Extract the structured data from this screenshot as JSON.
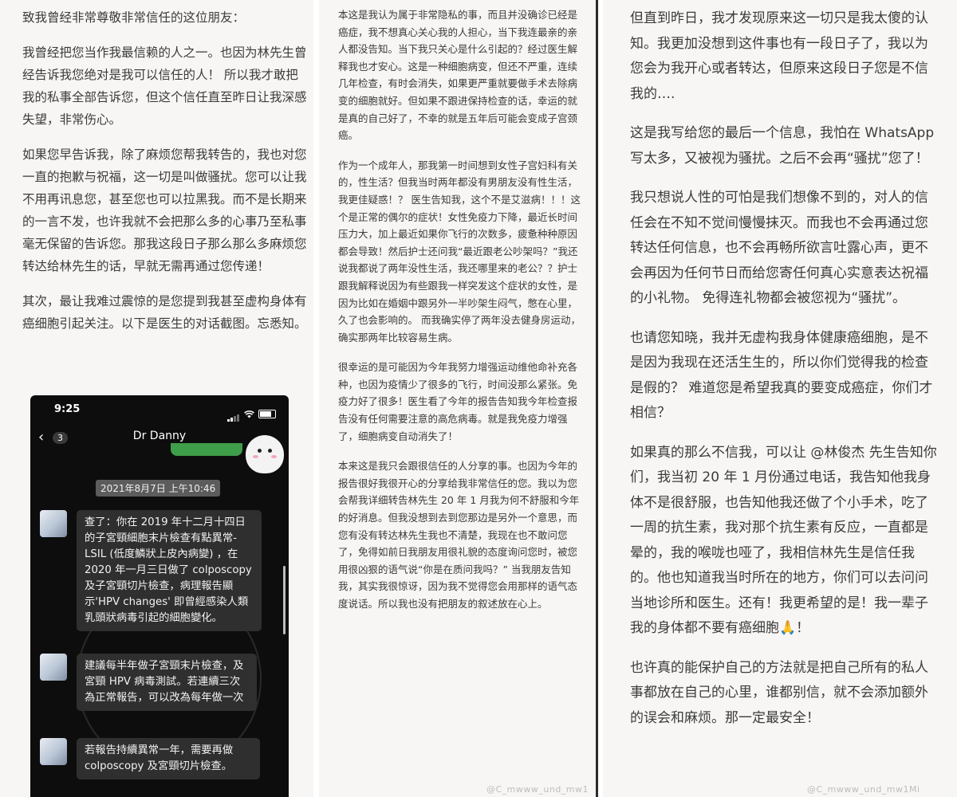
{
  "col1": {
    "paragraphs": [
      "致我曾经非常尊敬非常信任的这位朋友：",
      "我曾经把您当作我最信赖的人之一。也因为林先生曾经告诉我您绝对是我可以信任的人！ 所以我才敢把我的私事全部告诉您，但这个信任直至昨日让我深感失望，非常伤心。",
      "如果您早告诉我，除了麻烦您帮我转告的，我也对您一直的抱歉与祝福，这一切是叫做骚扰。您可以让我不用再讯息您，甚至您也可以拉黑我。而不是长期来的一言不发，也许我就不会把那么多的心事乃至私事毫无保留的告诉您。那我这段日子那么那么多麻烦您转达给林先生的话，早就无需再通过您传递！",
      "其次，最让我难过震惊的是您提到我甚至虚构身体有癌细胞引起关注。以下是医生的对话截图。忘悉知。"
    ]
  },
  "phone": {
    "time": "9:25",
    "back_count": "3",
    "chat_title": "Dr Danny",
    "date_pill": "2021年8月7日 上午10:46",
    "messages": [
      "查了：你在 2019 年十二月十四日的子宮頸細胞末片檢查有點異常-LSIL (低度鱗狀上皮內病變) ，在 2020 年一月三日做了 colposcopy 及子宮頸切片檢查，病理報告顯示'HPV changes' 即曾經感染人類乳頭狀病毒引起的細胞變化。",
      "建議每半年做子宮頸末片檢查，及宮頸 HPV 病毒測試。若連續三次為正常報告，可以改為每年做一次",
      "若報告持續異常一年，需要再做 colposcopy 及宮頸切片檢查。"
    ]
  },
  "col2": {
    "paragraphs": [
      "本这是我认为属于非常隐私的事，而且并没确诊已经是癌症，我不想真心关心我的人担心，当下我连最亲的亲人都没告知。当下我只关心是什么引起的？经过医生解释我也才安心。这是一种细胞病变，但还不严重，连续几年检查，有时会消失，如果更严重就要做手术去除病变的细胞就好。但如果不跟进保持检查的话，幸运的就是真的自己好了，不幸的就是五年后可能会变成子宫颈癌。",
      "作为一个成年人，那我第一时间想到女性子宫妇科有关的，性生活？但我当时两年都没有男朋友没有性生活，我更佳疑惑！？ 医生告知我，这个不是艾滋病！！！这个是正常的偶尔的症状！女性免疫力下降，最近长时间压力大，加上最近如果你飞行的次数多，疲惫种种原因都会导致！然后护士还问我“最近跟老公吵架吗？”我还说我都说了两年没性生活，我还哪里来的老公？？护士跟我解释说因为有些跟我一样突发这个症状的女性，是因为比如在婚姻中跟另外一半吵架生闷气，憋在心里，久了也会影响的。 而我确实停了两年没去健身房运动，确实那两年比较容易生病。",
      "很幸运的是可能因为今年我努力增强运动维他命补充各种，也因为疫情少了很多的飞行，时间没那么紧张。免疫力好了很多！医生看了今年的报告告知我今年检查报告没有任何需要注意的高危病毒。就是我免疫力增强了，细胞病变自动消失了！",
      "本来这是我只会跟很信任的人分享的事。也因为今年的报告很好我很开心的分享给我非常信任的您。我以为您会帮我详细转告林先生 20 年 1 月我为何不舒服和今年的好消息。但我没想到去到您那边是另外一个意思，而您有没有转达林先生我也不清楚，我现在也不敢问您了，免得如前日我朋友用很礼貌的态度询问您时，被您用很凶狠的语气说“你是在质问我吗？” 当我朋友告知我，其实我很惊讶，因为我不觉得您会用那样的语气态度说话。所以我也没有把朋友的叙述放在心上。"
    ],
    "watermark": "@C_mwww_und_mw1"
  },
  "col3": {
    "paragraphs": [
      "但直到昨日，我才发现原来这一切只是我太傻的认知。我更加没想到这件事也有一段日子了，我以为您会为我开心或者转达，但原来这段日子您是不信我的….",
      "这是我写给您的最后一个信息，我怕在 WhatsApp 写太多，又被视为骚扰。之后不会再“骚扰”您了！",
      "我只想说人性的可怕是我们想像不到的，对人的信任会在不知不觉间慢慢抹灭。而我也不会再通过您转达任何信息，也不会再畅所欲言吐露心声，更不会再因为任何节日而给您寄任何真心实意表达祝福的小礼物。 免得连礼物都会被您视为“骚扰”。",
      "也请您知晓，我并无虚构我身体健康癌细胞，是不是因为我现在还活生生的，所以你们觉得我的检查是假的？ 难道您是希望我真的要变成癌症，你们才相信？",
      "如果真的那么不信我，可以让 @林俊杰 先生告知你们，我当初 20 年 1 月份通过电话，我告知他我身体不是很舒服，也告知他我还做了个小手术，吃了一周的抗生素，我对那个抗生素有反应，一直都是晕的，我的喉咙也哑了，我相信林先生是信任我的。他也知道我当时所在的地方，你们可以去问问当地诊所和医生。还有！我更希望的是！我一辈子我的身体都不要有癌细胞🙏！",
      "也许真的能保护自己的方法就是把自己所有的私人事都放在自己的心里，谁都别信，就不会添加额外的误会和麻烦。那一定最安全！"
    ],
    "watermark": "@C_mwww_und_mw1Mi"
  },
  "colors": {
    "panel_bg": "#f7f6f4",
    "text": "#3b3b3b",
    "phone_bg": "#0d0d0d",
    "bubble": "#2f2f2f"
  }
}
